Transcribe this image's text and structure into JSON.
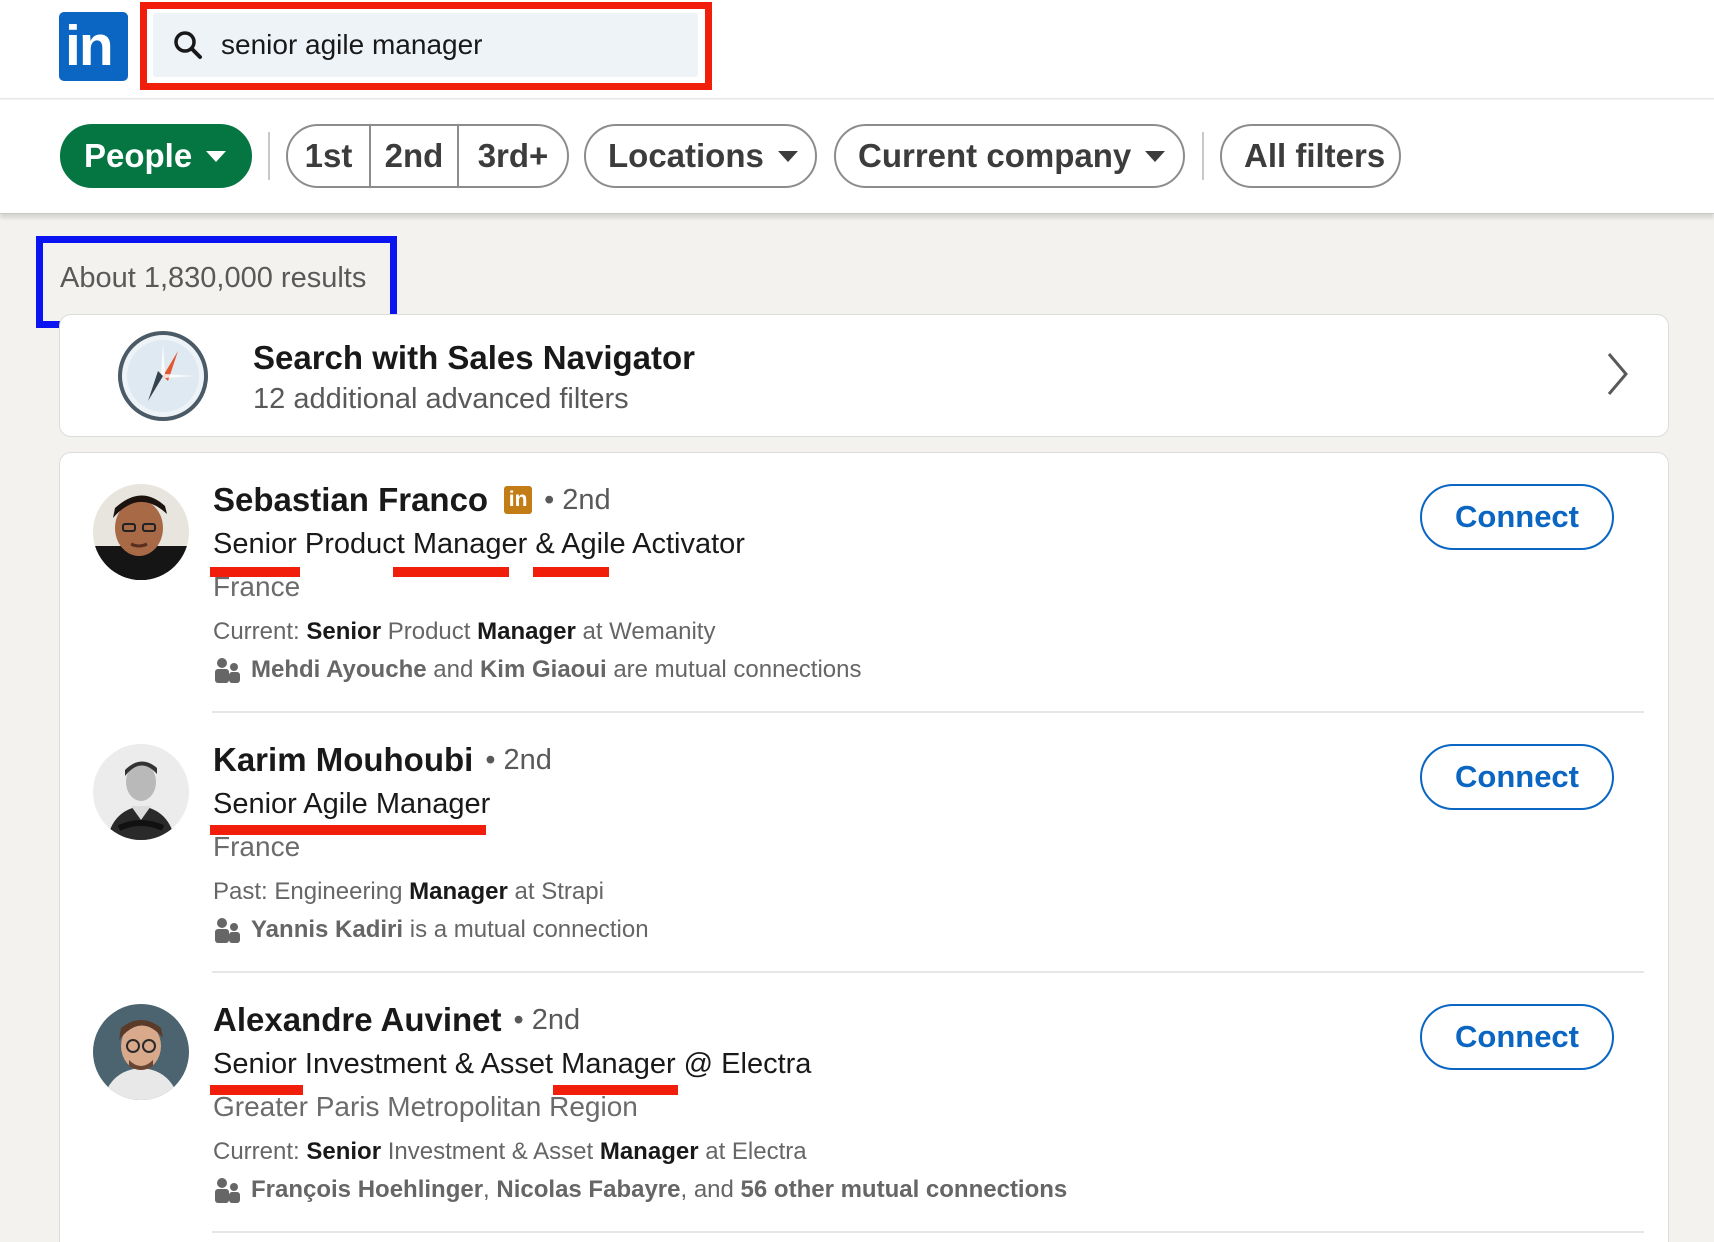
{
  "search": {
    "query": "senior agile manager"
  },
  "filters": {
    "people": "People",
    "degrees": [
      "1st",
      "2nd",
      "3rd+"
    ],
    "locations": "Locations",
    "current_company": "Current company",
    "all_filters": "All filters"
  },
  "results_count": "About 1,830,000 results",
  "sales_navigator": {
    "title": "Search with Sales Navigator",
    "subtitle": "12 additional advanced filters"
  },
  "results": [
    {
      "name": "Sebastian Franco",
      "degree": "• 2nd",
      "headline": "Senior Product Manager & Agile Activator",
      "location": "France",
      "current_label": "Current:",
      "current_w1": "Senior",
      "current_t1": "Product",
      "current_w2": "Manager",
      "current_t2": "at Wemanity",
      "mutual_a": "Mehdi Ayouche",
      "mutual_and": "and",
      "mutual_b": "Kim Giaoui",
      "mutual_tail": "are mutual connections",
      "connect": "Connect"
    },
    {
      "name": "Karim Mouhoubi",
      "degree": "• 2nd",
      "headline": "Senior Agile Manager",
      "location": "France",
      "current_label": "Past: Engineering",
      "current_w2": "Manager",
      "current_t2": "at Strapi",
      "mutual_a": "Yannis Kadiri",
      "mutual_tail": "is a mutual connection",
      "connect": "Connect"
    },
    {
      "name": "Alexandre Auvinet",
      "degree": "• 2nd",
      "headline": "Senior Investment & Asset Manager @ Electra",
      "location": "Greater Paris Metropolitan Region",
      "current_label": "Current:",
      "current_w1": "Senior",
      "current_t1": "Investment & Asset",
      "current_w2": "Manager",
      "current_t2": "at Electra",
      "mutual_a": "François Hoehlinger",
      "mutual_comma": ",",
      "mutual_b": "Nicolas Fabayre",
      "mutual_and": ", and",
      "mutual_c": "56 other mutual connections",
      "connect": "Connect"
    }
  ],
  "colors": {
    "linkedin_blue": "#0a66c2",
    "people_green": "#057642",
    "highlight_red": "#f01e0a",
    "highlight_blue": "#0a14f0"
  }
}
